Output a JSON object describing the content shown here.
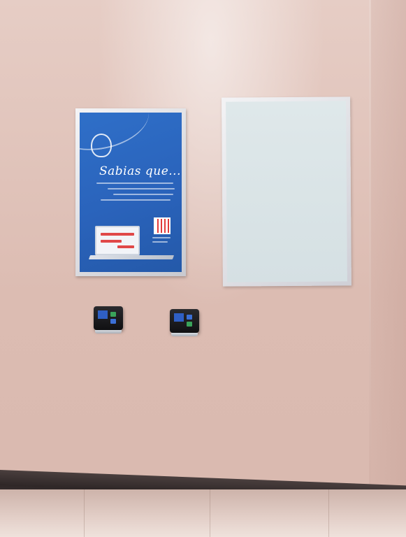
{
  "poster": {
    "title": "Sabias que..."
  },
  "colors": {
    "wall": "#dcbcb2",
    "poster_blue": "#2a63bb",
    "frame_silver": "#d8d8de",
    "baseboard": "#2f2727"
  }
}
